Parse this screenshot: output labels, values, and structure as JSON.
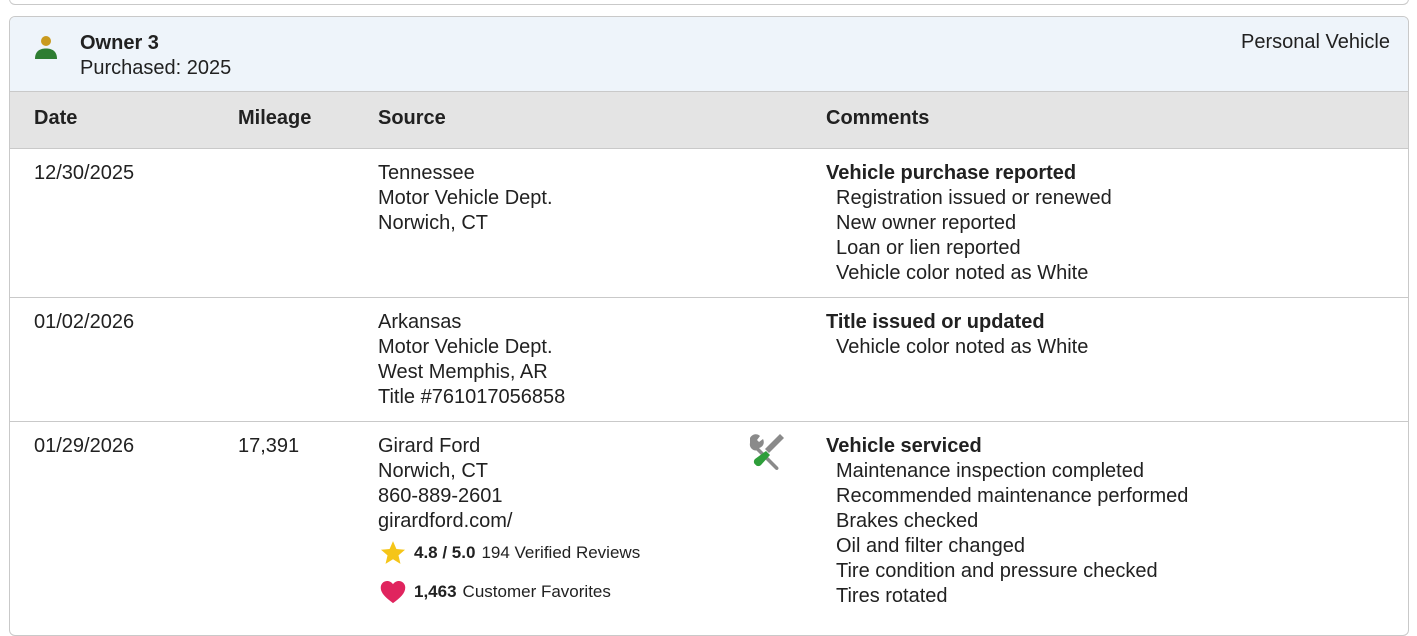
{
  "owner": {
    "title": "Owner 3",
    "purchased": "Purchased: 2025",
    "usage": "Personal Vehicle",
    "icon": "person-icon"
  },
  "table": {
    "headers": {
      "date": "Date",
      "mileage": "Mileage",
      "source": "Source",
      "comments": "Comments"
    },
    "rows": [
      {
        "date": "12/30/2025",
        "mileage": "",
        "source": [
          "Tennessee",
          "Motor Vehicle Dept.",
          "Norwich, CT"
        ],
        "comment_title": "Vehicle purchase reported",
        "comment_items": [
          "Registration issued or renewed",
          "New owner reported",
          "Loan or lien reported",
          "Vehicle color noted as White"
        ]
      },
      {
        "date": "01/02/2026",
        "mileage": "",
        "source": [
          "Arkansas",
          "Motor Vehicle Dept.",
          "West Memphis, AR",
          "Title #761017056858"
        ],
        "comment_title": "Title issued or updated",
        "comment_items": [
          "Vehicle color noted as White"
        ]
      },
      {
        "date": "01/29/2026",
        "mileage": "17,391",
        "source": [
          "Girard Ford",
          "Norwich, CT",
          "860-889-2601",
          "girardford.com/"
        ],
        "rating": {
          "value": "4.8 / 5.0",
          "reviews": "194 Verified Reviews",
          "icon": "star-icon",
          "color": "#f5c518"
        },
        "favorites": {
          "count": "1,463",
          "label": "Customer Favorites",
          "icon": "heart-icon",
          "color": "#e0245e"
        },
        "service_icon": "wrench-screwdriver-icon",
        "comment_title": "Vehicle serviced",
        "comment_items": [
          "Maintenance inspection completed",
          "Recommended maintenance performed",
          "Brakes checked",
          "Oil and filter changed",
          "Tire condition and pressure checked",
          "Tires rotated"
        ]
      }
    ]
  },
  "colors": {
    "header_bg": "#eef4fa",
    "table_header_bg": "#e4e4e4",
    "owner_icon_head": "#c99a1e",
    "owner_icon_body": "#2e7d32",
    "border": "#c9c9c9"
  }
}
